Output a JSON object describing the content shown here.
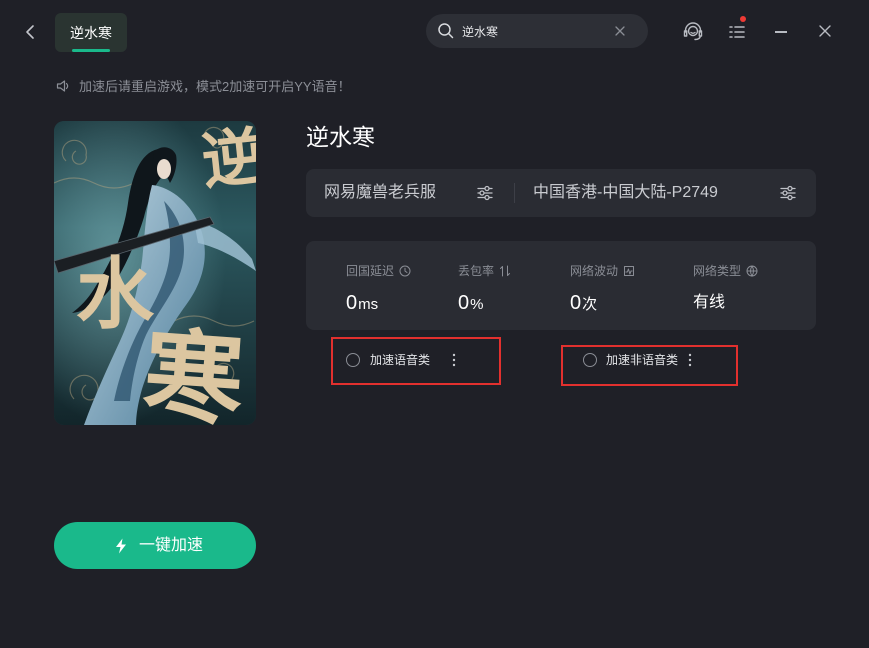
{
  "colors": {
    "background": "#1f2027",
    "panel": "#2a2c33",
    "accent": "#1ab98b",
    "highlight_border": "#e2302e",
    "badge": "#ee3a35"
  },
  "titlebar": {
    "back_icon": "chevron-left-icon",
    "tab": {
      "label": "逆水寒",
      "active": true
    },
    "search": {
      "icon": "search-icon",
      "value": "逆水寒",
      "clear_icon": "close-icon"
    },
    "actions": [
      {
        "icon": "headset-icon"
      },
      {
        "icon": "menu-list-icon",
        "badge": true
      },
      {
        "icon": "minimize-icon"
      },
      {
        "icon": "close-icon"
      }
    ]
  },
  "notice": {
    "icon": "speaker-icon",
    "text": "加速后请重启游戏，模式2加速可开启YY语音！"
  },
  "game": {
    "cover_lettering": [
      "逆",
      "水",
      "寒"
    ],
    "title": "逆水寒",
    "server": {
      "name": "网易魔兽老兵服",
      "icon": "sliders-icon"
    },
    "route": {
      "name": "中国香港-中国大陆-P2749",
      "icon": "sliders-icon"
    }
  },
  "stats": [
    {
      "label": "回国延迟",
      "icon": "clock-icon",
      "value": "0",
      "unit": "ms"
    },
    {
      "label": "丢包率",
      "icon": "swap-vertical-icon",
      "value": "0",
      "unit": "%"
    },
    {
      "label": "网络波动",
      "icon": "pulse-icon",
      "value": "0",
      "unit": "次"
    },
    {
      "label": "网络类型",
      "icon": "globe-icon",
      "value": "有线"
    }
  ],
  "modes": [
    {
      "label": "加速语音类",
      "selected": false,
      "menu_icon": "more-vertical-icon"
    },
    {
      "label": "加速非语音类",
      "selected": false,
      "menu_icon": "more-vertical-icon"
    }
  ],
  "boost_button": {
    "icon": "lightning-icon",
    "label": "一键加速"
  }
}
